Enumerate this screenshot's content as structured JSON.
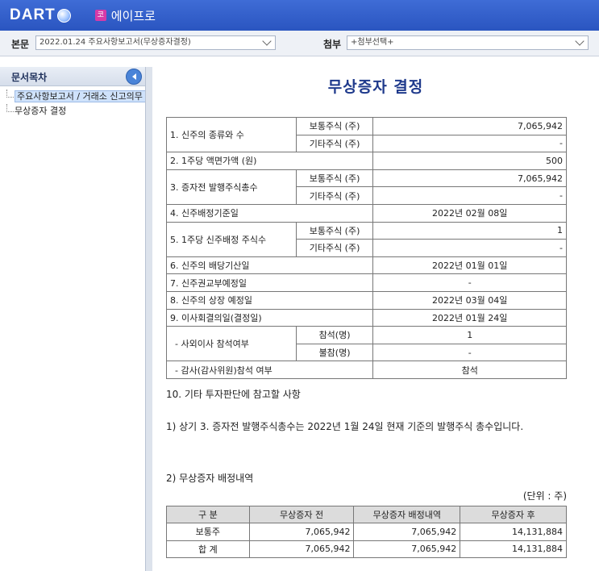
{
  "header": {
    "logo_text": "DART",
    "company_badge": "코",
    "company_name": "에이프로"
  },
  "selectbar": {
    "main_label": "본문",
    "main_value": "2022.01.24  주요사항보고서(무상증자결정)",
    "attach_label": "첨부",
    "attach_value": "+첨부선택+"
  },
  "sidebar": {
    "title": "문서목차",
    "items": [
      {
        "label": "주요사항보고서 / 거래소 신고의무 사항"
      },
      {
        "label": "무상증자 결정"
      }
    ]
  },
  "document": {
    "title": "무상증자 결정",
    "rows": {
      "r1_label": "1. 신주의 종류와 수",
      "r1_common_label": "보통주식 (주)",
      "r1_common_value": "7,065,942",
      "r1_other_label": "기타주식 (주)",
      "r1_other_value": "-",
      "r2_label": "2. 1주당 액면가액 (원)",
      "r2_value": "500",
      "r3_label": "3. 증자전 발행주식총수",
      "r3_common_label": "보통주식 (주)",
      "r3_common_value": "7,065,942",
      "r3_other_label": "기타주식 (주)",
      "r3_other_value": "-",
      "r4_label": "4. 신주배정기준일",
      "r4_value": "2022년 02월 08일",
      "r5_label": "5. 1주당 신주배정 주식수",
      "r5_common_label": "보통주식 (주)",
      "r5_common_value": "1",
      "r5_other_label": "기타주식 (주)",
      "r5_other_value": "-",
      "r6_label": "6. 신주의 배당기산일",
      "r6_value": "2022년 01월 01일",
      "r7_label": "7. 신주권교부예정일",
      "r7_value": "-",
      "r8_label": "8. 신주의 상장 예정일",
      "r8_value": "2022년 03월 04일",
      "r9_label": "9. 이사회결의일(결정일)",
      "r9_value": "2022년 01월 24일",
      "outside_label": "- 사외이사 참석여부",
      "present_label": "참석(명)",
      "present_value": "1",
      "absent_label": "불참(명)",
      "absent_value": "-",
      "auditor_label": "- 감사(감사위원)참석 여부",
      "auditor_value": "참석"
    },
    "section10": "10. 기타 투자판단에 참고할 사항",
    "note1": "1) 상기 3. 증자전 발행주식총수는 2022년 1월 24일 현재 기준의 발행주식 총수입니다.",
    "note2": "2) 무상증자 배정내역",
    "unit": "(단위 : 주)",
    "dist_headers": [
      "구  분",
      "무상증자 전",
      "무상증자 배정내역",
      "무상증자 후"
    ],
    "dist_rows": [
      [
        "보통주",
        "7,065,942",
        "7,065,942",
        "14,131,884"
      ],
      [
        "합  계",
        "7,065,942",
        "7,065,942",
        "14,131,884"
      ]
    ]
  },
  "colors": {
    "header_bg": "#2f5bc8",
    "title_color": "#1f3a8c",
    "badge": "#d63aa8"
  }
}
